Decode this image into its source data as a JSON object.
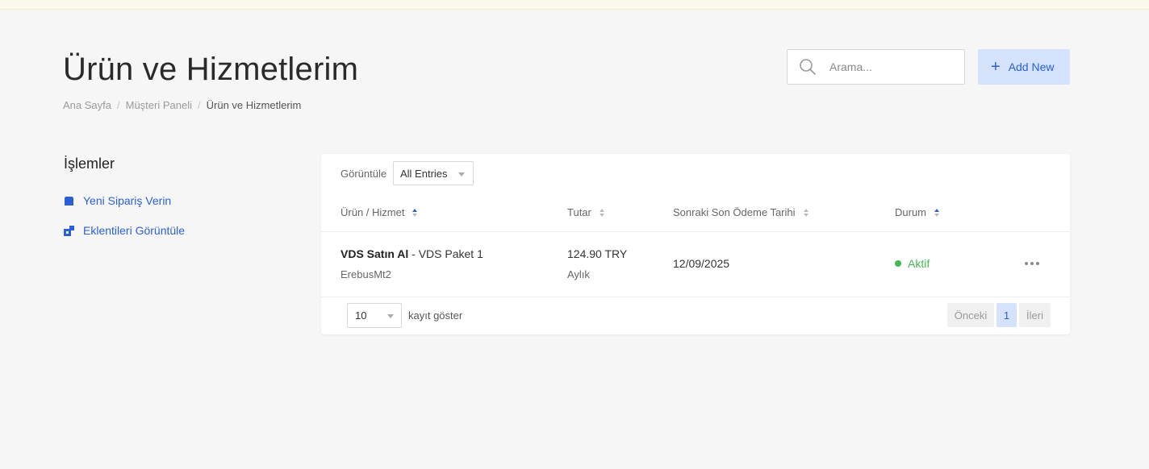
{
  "page": {
    "title": "Ürün ve Hizmetlerim",
    "breadcrumb": [
      "Ana Sayfa",
      "Müşteri Paneli",
      "Ürün ve Hizmetlerim"
    ]
  },
  "header": {
    "search_placeholder": "Arama...",
    "add_new_label": "Add New"
  },
  "sidebar": {
    "title": "İşlemler",
    "items": [
      {
        "label": "Yeni Sipariş Verin",
        "icon": "cart-icon"
      },
      {
        "label": "Eklentileri Görüntüle",
        "icon": "addons-icon"
      }
    ]
  },
  "table": {
    "filter_label": "Görüntüle",
    "filter_value": "All Entries",
    "columns": [
      "Ürün / Hizmet",
      "Tutar",
      "Sonraki Son Ödeme Tarihi",
      "Durum"
    ],
    "rows": [
      {
        "product_bold": "VDS Satın Al",
        "product_rest": " - VDS Paket 1",
        "domain": "ErebusMt2",
        "amount": "124.90 TRY",
        "cycle": "Aylık",
        "due_date": "12/09/2025",
        "status": "Aktif"
      }
    ],
    "length_value": "10",
    "length_label": "kayıt göster",
    "pagination": {
      "prev": "Önceki",
      "page": "1",
      "next": "İleri"
    }
  },
  "colors": {
    "accent": "#2a5fd8",
    "accent_light": "#d4e2fb",
    "status_active": "#3fb950"
  }
}
